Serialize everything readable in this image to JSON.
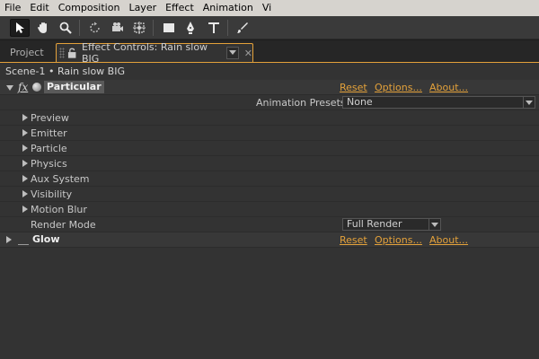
{
  "menu": [
    "File",
    "Edit",
    "Composition",
    "Layer",
    "Effect",
    "Animation",
    "Vi"
  ],
  "tools": [
    {
      "icon": "selection-arrow-icon",
      "active": true
    },
    {
      "icon": "hand-icon"
    },
    {
      "icon": "zoom-icon"
    },
    {
      "icon": "rotate-icon"
    },
    {
      "icon": "camera-orbit-icon"
    },
    {
      "icon": "pan-behind-icon"
    },
    {
      "icon": "rectangle-mask-icon"
    },
    {
      "icon": "pen-icon"
    },
    {
      "icon": "type-icon"
    },
    {
      "icon": "brush-icon"
    }
  ],
  "tabs": {
    "project": "Project",
    "effect_controls": "Effect Controls: Rain slow BIG"
  },
  "breadcrumb": "Scene-1 • Rain slow BIG",
  "particular": {
    "name": "Particular",
    "fx": "fx",
    "reset": "Reset",
    "options": "Options...",
    "about": "About...",
    "presets_label": "Animation Presets:",
    "presets_value": "None",
    "groups": [
      "Preview",
      "Emitter",
      "Particle",
      "Physics",
      "Aux System",
      "Visibility",
      "Motion Blur"
    ],
    "render_mode_label": "Render Mode",
    "render_mode_value": "Full Render"
  },
  "glow": {
    "name": "Glow",
    "reset": "Reset",
    "options": "Options...",
    "about": "About..."
  },
  "colors": {
    "accent": "#e3a13a",
    "panel": "#333333",
    "menubar": "#d6d3ce"
  }
}
